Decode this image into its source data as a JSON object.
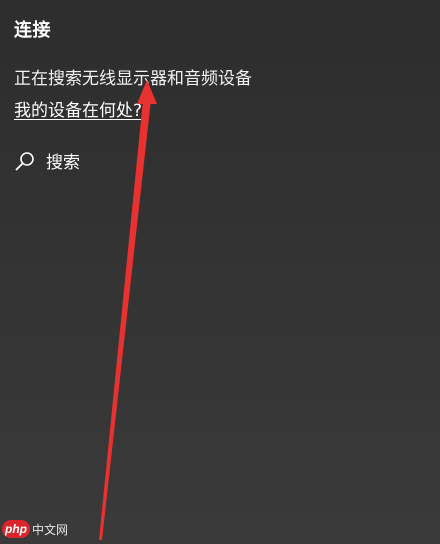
{
  "panel": {
    "title": "连接",
    "status_text": "正在搜索无线显示器和音频设备",
    "help_link": "我的设备在何处?",
    "search_label": "搜索"
  },
  "watermark": {
    "logo_text": "php",
    "site_text": "中文网"
  },
  "colors": {
    "background": "#333333",
    "text": "#ffffff",
    "annotation_arrow": "#e8322f"
  },
  "icons": {
    "search": "search-icon",
    "annotation": "red-arrow-icon"
  }
}
